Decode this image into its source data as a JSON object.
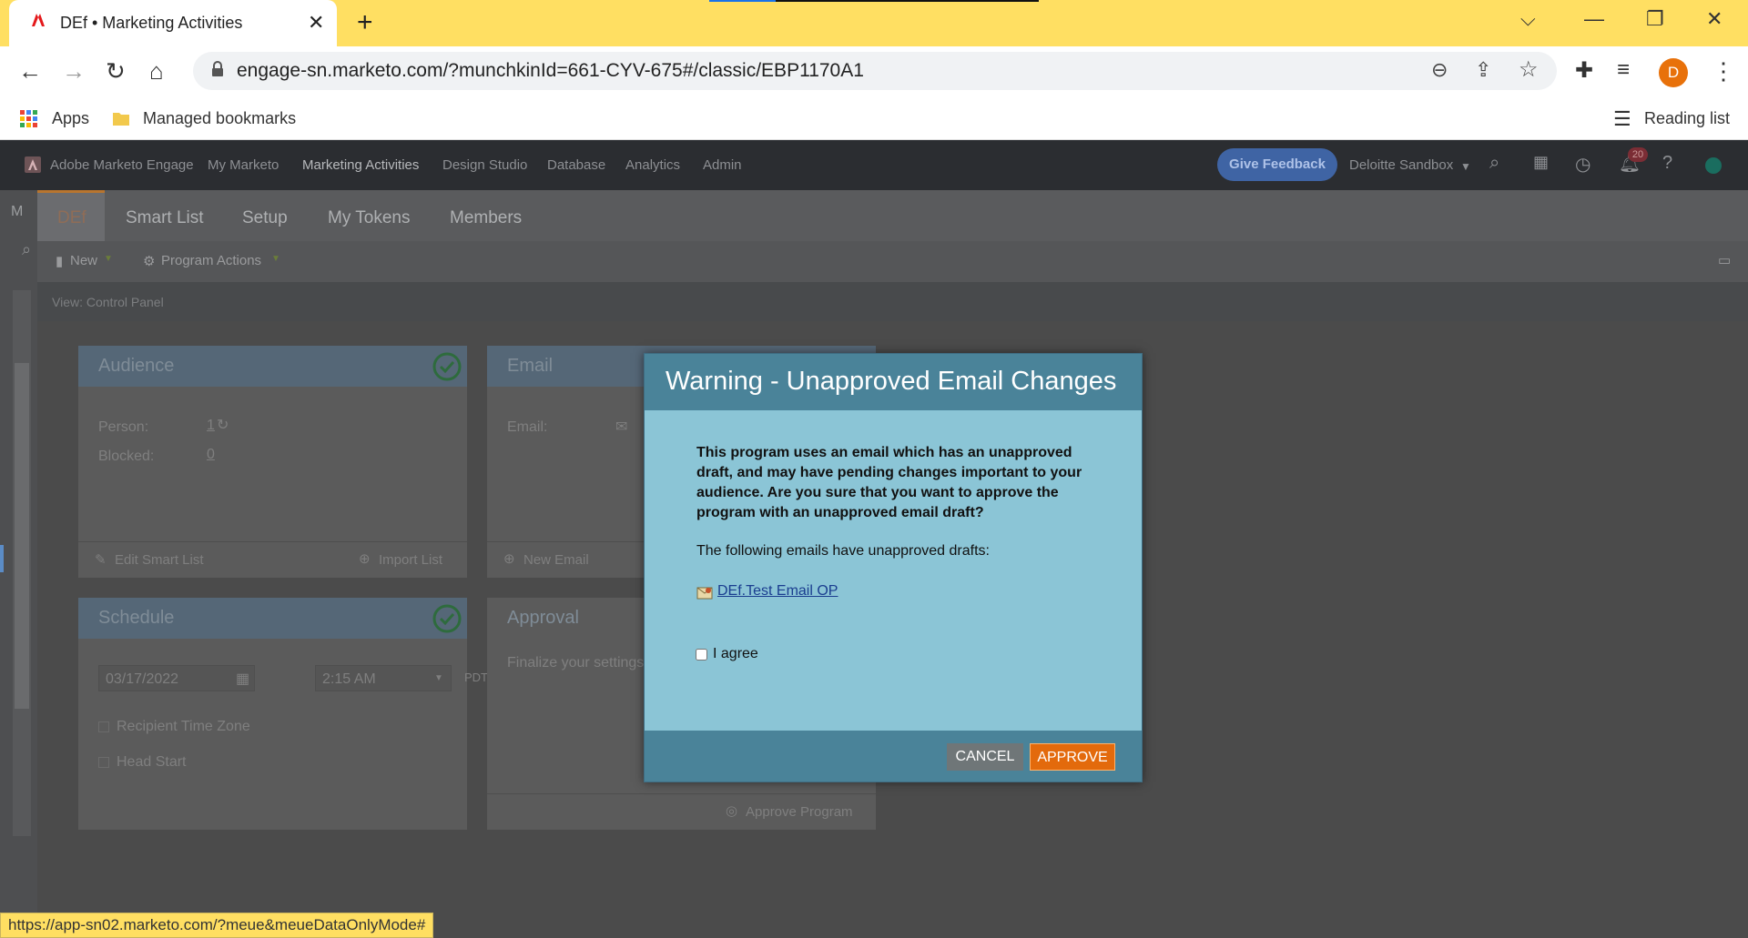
{
  "browser": {
    "tab_title": "DEf • Marketing Activities",
    "url": "engage-sn.marketo.com/?munchkinId=661-CYV-675#/classic/EBP1170A1",
    "avatar_letter": "D",
    "bookmarks": {
      "apps": "Apps",
      "managed": "Managed bookmarks",
      "reading_list": "Reading list"
    },
    "status_url": "https://app-sn02.marketo.com/?meue&meueDataOnlyMode#"
  },
  "app_nav": {
    "brand": "Adobe Marketo Engage",
    "items": [
      "My Marketo",
      "Marketing Activities",
      "Design Studio",
      "Database",
      "Analytics",
      "Admin"
    ],
    "give_feedback": "Give Feedback",
    "workspace": "Deloitte Sandbox",
    "notification_count": "20"
  },
  "left_rail": {
    "letter": "M"
  },
  "subtabs": [
    "DEf",
    "Smart List",
    "Setup",
    "My Tokens",
    "Members"
  ],
  "actions": {
    "new": "New",
    "program_actions": "Program Actions"
  },
  "view": "View: Control Panel",
  "audience": {
    "title": "Audience",
    "person_label": "Person:",
    "person_value": "1",
    "blocked_label": "Blocked:",
    "blocked_value": "0",
    "edit_smart_list": "Edit Smart List",
    "import_list": "Import List"
  },
  "email": {
    "title": "Email",
    "email_label": "Email:",
    "new_email": "New Email"
  },
  "schedule": {
    "title": "Schedule",
    "date": "03/17/2022",
    "time": "2:15 AM",
    "tz": "PDT",
    "recipient_tz": "Recipient Time Zone",
    "head_start": "Head Start"
  },
  "approval": {
    "title": "Approval",
    "text": "Finalize your settings",
    "approve_program": "Approve Program"
  },
  "modal": {
    "title": "Warning - Unapproved Email Changes",
    "message": "This program uses an email which has an unapproved draft, and may have pending changes important to your audience. Are you sure that you want to approve the program with an unapproved email draft?",
    "sub": "The following emails have unapproved drafts:",
    "email_link": "DEf.Test Email OP",
    "agree_label": "I agree",
    "cancel": "CANCEL",
    "approve": "APPROVE"
  },
  "colors": {
    "accent_orange": "#e36a0c",
    "modal_header": "#4a8399",
    "modal_body": "#8bc5d6",
    "tabstrip": "#ffdf62"
  }
}
